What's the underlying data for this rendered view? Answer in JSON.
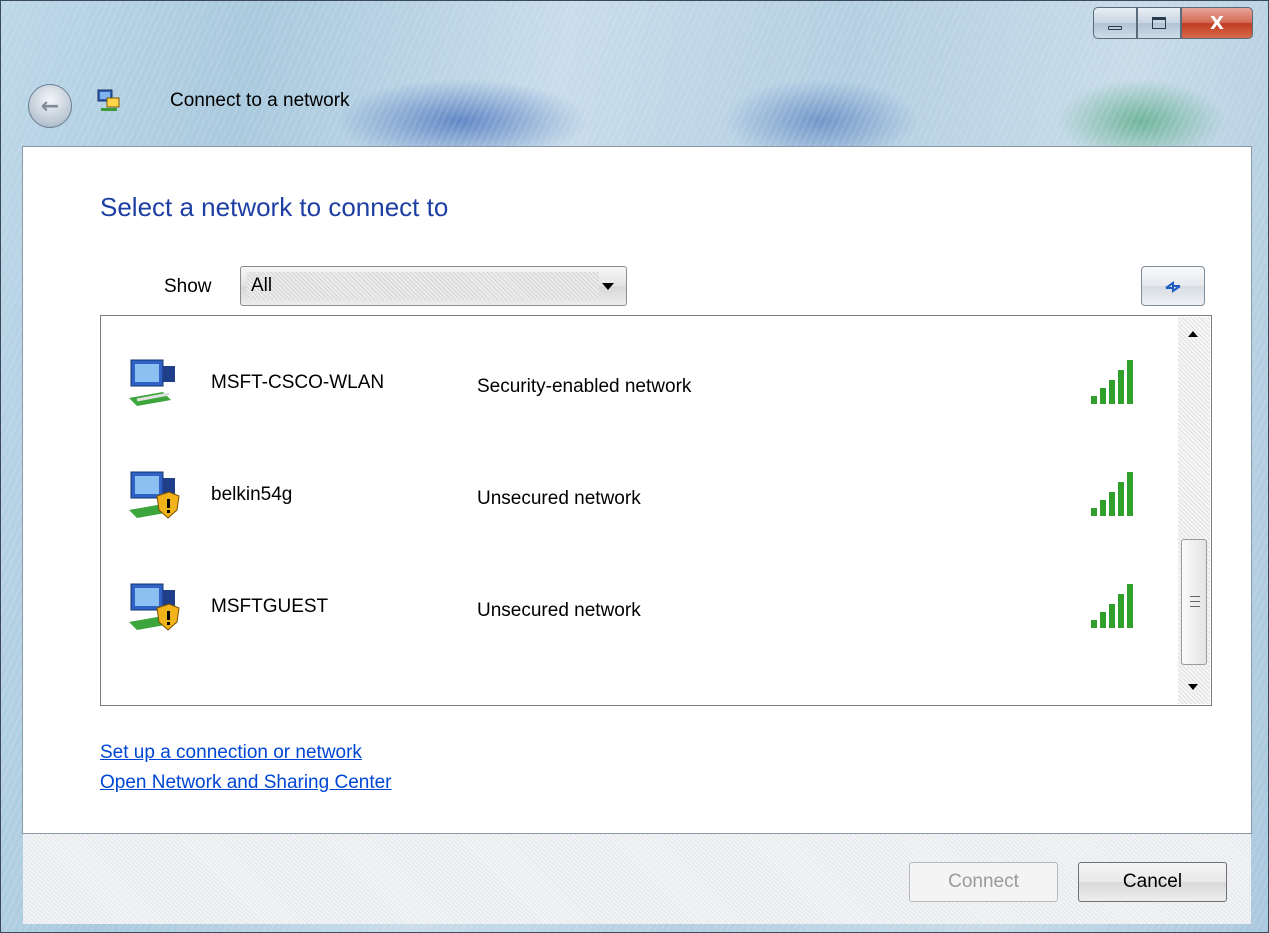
{
  "window": {
    "title": "Connect to a network",
    "minimize_label": "",
    "maximize_label": "",
    "close_label": "X"
  },
  "page": {
    "heading": "Select a network to connect to",
    "show_label": "Show",
    "show_value": "All"
  },
  "networks": [
    {
      "name": "MSFT-CSCO-WLAN",
      "security": "Security-enabled network",
      "secured": true,
      "signal_bars": 5
    },
    {
      "name": "belkin54g",
      "security": "Unsecured network",
      "secured": false,
      "signal_bars": 5
    },
    {
      "name": "MSFTGUEST",
      "security": "Unsecured network",
      "secured": false,
      "signal_bars": 5
    }
  ],
  "links": {
    "setup": "Set up a connection or network",
    "sharing_center": "Open Network and Sharing Center"
  },
  "buttons": {
    "connect": "Connect",
    "cancel": "Cancel"
  },
  "colors": {
    "heading": "#1d3fa3",
    "link": "#0046d5",
    "signal": "#2fa12a",
    "close_button": "#c8452a"
  }
}
